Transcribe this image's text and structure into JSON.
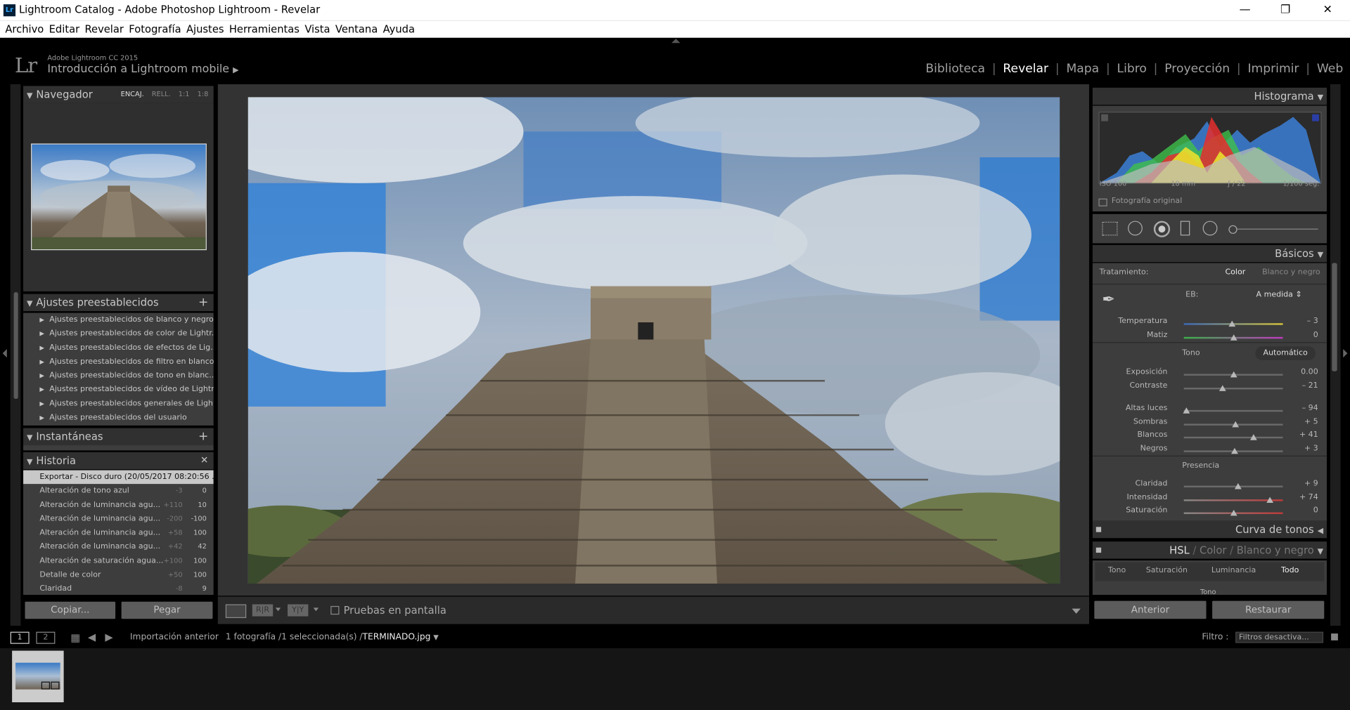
{
  "window": {
    "title": "Lightroom Catalog - Adobe Photoshop Lightroom - Revelar",
    "app_icon": "Lr"
  },
  "menu": [
    "Archivo",
    "Editar",
    "Revelar",
    "Fotografía",
    "Ajustes",
    "Herramientas",
    "Vista",
    "Ventana",
    "Ayuda"
  ],
  "identity": {
    "logo": "Lr",
    "product": "Adobe Lightroom CC 2015",
    "subtitle": "Introducción a Lightroom mobile"
  },
  "modules": [
    "Biblioteca",
    "Revelar",
    "Mapa",
    "Libro",
    "Proyección",
    "Imprimir",
    "Web"
  ],
  "active_module": "Revelar",
  "navigator": {
    "title": "Navegador",
    "zoom": [
      "ENCAJ.",
      "RELL.",
      "1:1",
      "1:8"
    ]
  },
  "presets": {
    "title": "Ajustes preestablecidos",
    "items": [
      "Ajustes preestablecidos de blanco y negro...",
      "Ajustes preestablecidos de color de Lightr...",
      "Ajustes preestablecidos de efectos de Lig...",
      "Ajustes preestablecidos de filtro en blanco...",
      "Ajustes preestablecidos de tono en blanc...",
      "Ajustes preestablecidos de vídeo de Lightr...",
      "Ajustes preestablecidos generales de Ligh...",
      "Ajustes preestablecidos del usuario"
    ]
  },
  "snapshots": {
    "title": "Instantáneas"
  },
  "history": {
    "title": "Historia",
    "items": [
      {
        "label": "Exportar - Disco duro (20/05/2017 08:20:56 ...",
        "delta": "",
        "value": ""
      },
      {
        "label": "Alteración de tono azul",
        "delta": "-3",
        "value": "0"
      },
      {
        "label": "Alteración de luminancia agu...",
        "delta": "+110",
        "value": "10"
      },
      {
        "label": "Alteración de luminancia agu...",
        "delta": "-200",
        "value": "-100"
      },
      {
        "label": "Alteración de luminancia agu...",
        "delta": "+58",
        "value": "100"
      },
      {
        "label": "Alteración de luminancia agu...",
        "delta": "+42",
        "value": "42"
      },
      {
        "label": "Alteración de saturación agua...",
        "delta": "+100",
        "value": "100"
      },
      {
        "label": "Detalle de color",
        "delta": "+50",
        "value": "100"
      },
      {
        "label": "Claridad",
        "delta": "-8",
        "value": "9"
      }
    ]
  },
  "left_buttons": {
    "copy": "Copiar...",
    "paste": "Pegar"
  },
  "toolbar": {
    "soft_proof": "Pruebas en pantalla"
  },
  "histogram": {
    "title": "Histograma",
    "iso": "ISO 100",
    "focal": "18 mm",
    "aperture": "ƒ / 22",
    "shutter": "1/100 seg.",
    "original": "Fotografía original"
  },
  "basic": {
    "title": "Básicos",
    "treatment_label": "Tratamiento:",
    "treatment_color": "Color",
    "treatment_bw": "Blanco y negro",
    "wb_label": "EB:",
    "wb_value": "A medida",
    "tone_label": "Tono",
    "auto": "Automático",
    "presence_label": "Presencia",
    "sliders": [
      {
        "label": "Temperatura",
        "display": "– 3",
        "value": -3,
        "min": -100,
        "max": 100
      },
      {
        "label": "Matiz",
        "display": "0",
        "value": 0,
        "min": -150,
        "max": 150
      },
      {
        "label": "Exposición",
        "display": "0.00",
        "value": 0,
        "min": -5,
        "max": 5
      },
      {
        "label": "Contraste",
        "display": "– 21",
        "value": -21,
        "min": -100,
        "max": 100
      },
      {
        "label": "Altas luces",
        "display": "– 94",
        "value": -94,
        "min": -100,
        "max": 100
      },
      {
        "label": "Sombras",
        "display": "+ 5",
        "value": 5,
        "min": -100,
        "max": 100
      },
      {
        "label": "Blancos",
        "display": "+ 41",
        "value": 41,
        "min": -100,
        "max": 100
      },
      {
        "label": "Negros",
        "display": "+ 3",
        "value": 3,
        "min": -100,
        "max": 100
      },
      {
        "label": "Claridad",
        "display": "+ 9",
        "value": 9,
        "min": -100,
        "max": 100
      },
      {
        "label": "Intensidad",
        "display": "+ 74",
        "value": 74,
        "min": -100,
        "max": 100
      },
      {
        "label": "Saturación",
        "display": "0",
        "value": 0,
        "min": -100,
        "max": 100
      }
    ]
  },
  "tone_curve": {
    "title": "Curva de tonos"
  },
  "hsl": {
    "tabs": [
      "HSL",
      "Color",
      "Blanco y negro"
    ],
    "subtabs": [
      "Tono",
      "Saturación",
      "Luminancia",
      "Todo"
    ],
    "sub_section": "Tono"
  },
  "right_buttons": {
    "previous": "Anterior",
    "reset": "Restaurar"
  },
  "filmstrip": {
    "source": "Importación anterior",
    "info": "1 fotografía /1 seleccionada(s) /",
    "filename": "TERMINADO.jpg",
    "filter_label": "Filtro :",
    "filter_value": "Filtros desactiva...",
    "screen1": "1",
    "screen2": "2"
  },
  "colors": {
    "panel": "#3d3d3d",
    "header": "#303030",
    "bg": "#000000",
    "active": "#ffffff"
  }
}
